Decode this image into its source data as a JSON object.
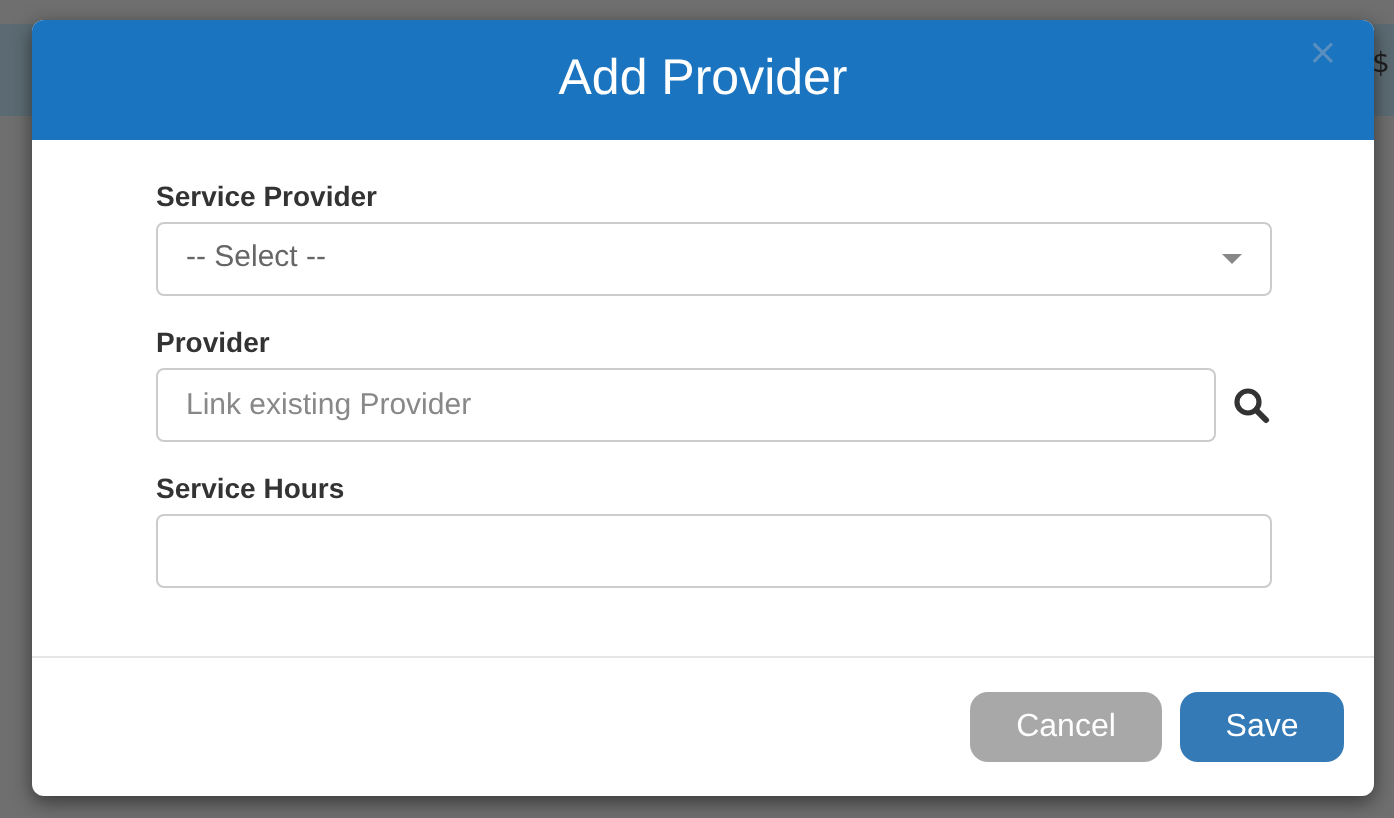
{
  "background": {
    "right_fragments": [
      "$"
    ]
  },
  "modal": {
    "title": "Add Provider",
    "close": "×",
    "fields": [
      {
        "kind": "select",
        "label": "Service Provider",
        "value": "-- Select --"
      },
      {
        "kind": "search",
        "label": "Provider",
        "placeholder": "Link existing Provider"
      },
      {
        "kind": "text",
        "label": "Service Hours"
      }
    ],
    "buttons": [
      {
        "label": "Cancel",
        "kind": "secondary",
        "disabled": true
      },
      {
        "label": "Save",
        "kind": "primary",
        "disabled": false
      }
    ]
  }
}
